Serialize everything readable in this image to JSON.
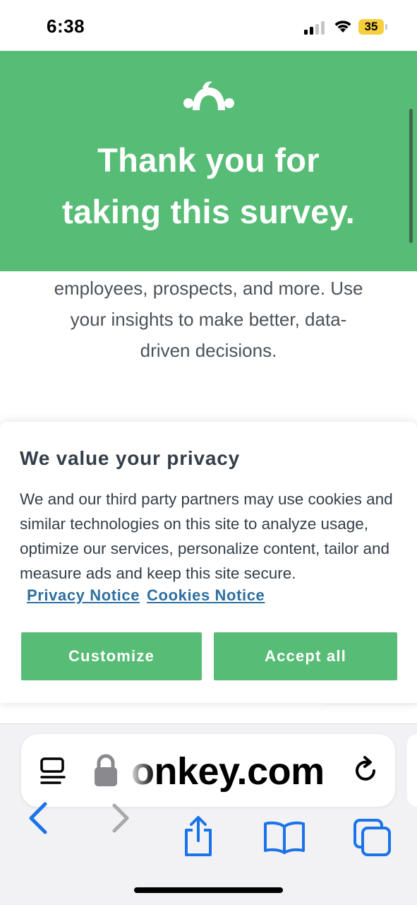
{
  "status_bar": {
    "time": "6:38",
    "battery": "35"
  },
  "hero": {
    "title": "Thank you for\ntaking this survey."
  },
  "body": {
    "text": "employees, prospects, and more. Use\nyour insights to make better, data-\ndriven decisions."
  },
  "cookie_banner": {
    "title": "We value your privacy",
    "text": "We and our third party partners may use cookies and similar technologies on this site to analyze usage, optimize our services, personalize content, tailor and measure ads and keep this site secure.",
    "privacy_link": "Privacy Notice",
    "cookies_link": "Cookies Notice",
    "customize_label": "Customize",
    "accept_label": "Accept all"
  },
  "browser": {
    "url": "onkey.com"
  },
  "colors": {
    "brand_green": "#57bc75",
    "link_blue": "#2f6f9f",
    "ios_blue": "#1a73e8"
  },
  "icons": [
    "cellular-signal-icon",
    "wifi-icon",
    "battery-icon",
    "surveymonkey-logo-icon",
    "reader-mode-icon",
    "lock-icon",
    "reload-icon",
    "back-icon",
    "forward-icon",
    "share-icon",
    "bookmarks-icon",
    "tabs-icon"
  ]
}
